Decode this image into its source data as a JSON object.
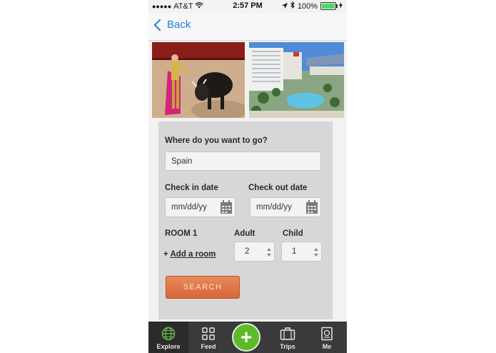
{
  "status": {
    "signal_dots": "●●●●●",
    "carrier": "AT&T",
    "time": "2:57 PM",
    "battery_percent": "100%"
  },
  "nav": {
    "back_label": "Back"
  },
  "form": {
    "destination_label": "Where do you want to go?",
    "destination_value": "Spain",
    "checkin_label": "Check in date",
    "checkin_placeholder": "mm/dd/yy",
    "checkout_label": "Check out date",
    "checkout_placeholder": "mm/dd/yy",
    "room_label": "ROOM 1",
    "adult_label": "Adult",
    "child_label": "Child",
    "adult_value": "2",
    "child_value": "1",
    "add_room_prefix": "+",
    "add_room_label": "Add a room",
    "search_label": "SEARCH"
  },
  "tabs": [
    {
      "label": "Explore",
      "icon": "globe-icon"
    },
    {
      "label": "Feed",
      "icon": "grid-icon"
    },
    {
      "label": "",
      "icon": "plus-icon"
    },
    {
      "label": "Trips",
      "icon": "suitcase-icon"
    },
    {
      "label": "Me",
      "icon": "passport-icon"
    }
  ],
  "colors": {
    "accent": "#1e7fd9",
    "search_button": "#e0744a",
    "plus_button": "#5dbb2a",
    "tabbar": "#3a3a3a"
  }
}
